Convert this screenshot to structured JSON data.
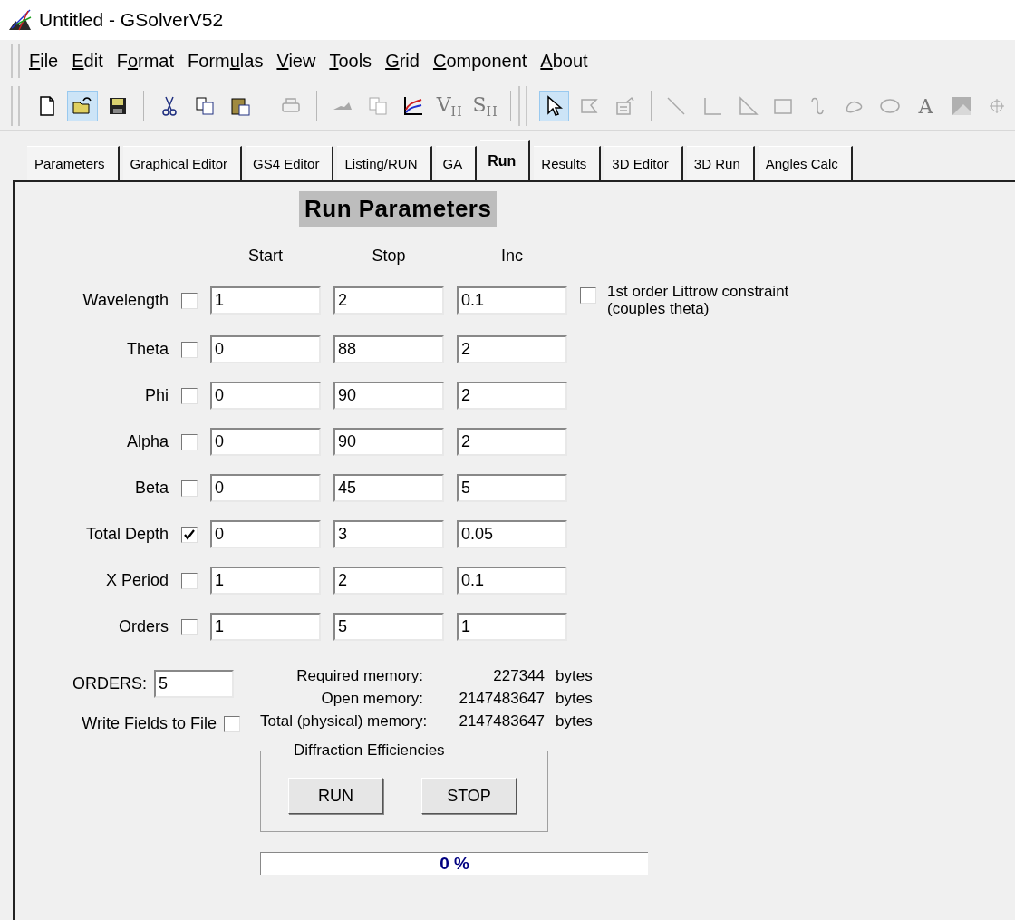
{
  "window": {
    "title": "Untitled - GSolverV52"
  },
  "menu": [
    {
      "key": "F",
      "post": "ile"
    },
    {
      "key": "E",
      "post": "dit"
    },
    {
      "pre": "F",
      "key": "o",
      "post": "rmat"
    },
    {
      "pre": "Form",
      "key": "u",
      "post": "las"
    },
    {
      "key": "V",
      "post": "iew"
    },
    {
      "key": "T",
      "post": "ools"
    },
    {
      "key": "G",
      "post": "rid"
    },
    {
      "key": "C",
      "post": "omponent"
    },
    {
      "key": "A",
      "post": "bout"
    }
  ],
  "toolbar": [
    [
      {
        "disabled": false,
        "pressed": false
      },
      {
        "disabled": false,
        "pressed": true
      },
      {
        "disabled": false,
        "pressed": false
      }
    ],
    [
      {
        "disabled": false,
        "pressed": false
      },
      {
        "disabled": false,
        "pressed": false
      },
      {
        "disabled": false,
        "pressed": false
      }
    ],
    [
      {
        "disabled": true,
        "pressed": false
      }
    ],
    [
      {
        "disabled": true,
        "pressed": false
      },
      {
        "disabled": true,
        "pressed": false
      },
      {
        "disabled": false,
        "pressed": false
      },
      {
        "disabled": true,
        "pressed": false,
        "label": "V$_{H}$"
      },
      {
        "disabled": true,
        "pressed": false,
        "label": "S$_{H}$"
      }
    ]
  ],
  "drawing_toolbar": [
    [
      {
        "disabled": false,
        "pressed": true
      },
      {
        "disabled": true,
        "pressed": false
      },
      {
        "disabled": true,
        "pressed": false
      }
    ],
    [
      {
        "disabled": true,
        "pressed": false
      },
      {
        "disabled": true,
        "pressed": false
      },
      {
        "disabled": true,
        "pressed": false
      },
      {
        "disabled": true,
        "pressed": false
      },
      {
        "disabled": true,
        "pressed": false
      },
      {
        "disabled": true,
        "pressed": false
      },
      {
        "disabled": true,
        "pressed": false
      },
      {
        "disabled": true,
        "pressed": false,
        "label": "A"
      },
      {
        "disabled": true,
        "pressed": false
      },
      {
        "disabled": true,
        "pressed": false
      }
    ]
  ],
  "tabs": [
    {
      "label": "Parameters",
      "selected": false
    },
    {
      "label": "Graphical Editor",
      "selected": false
    },
    {
      "label": "GS4 Editor",
      "selected": false
    },
    {
      "label": "Listing/RUN",
      "selected": false
    },
    {
      "label": "GA",
      "selected": false
    },
    {
      "label": "Run",
      "selected": true
    },
    {
      "label": "Results",
      "selected": false
    },
    {
      "label": "3D Editor",
      "selected": false
    },
    {
      "label": "3D Run",
      "selected": false
    },
    {
      "label": "Angles Calc",
      "selected": false
    }
  ],
  "heading": "Run Parameters",
  "columns": [
    "Start",
    "Stop",
    "Inc"
  ],
  "rows": [
    {
      "label": "Wavelength",
      "checked": false,
      "start": "1",
      "stop": "2",
      "inc": "0.1"
    },
    {
      "label": "Theta",
      "checked": false,
      "start": "0",
      "stop": "88",
      "inc": "2"
    },
    {
      "label": "Phi",
      "checked": false,
      "start": "0",
      "stop": "90",
      "inc": "2"
    },
    {
      "label": "Alpha",
      "checked": false,
      "start": "0",
      "stop": "90",
      "inc": "2"
    },
    {
      "label": "Beta",
      "checked": false,
      "start": "0",
      "stop": "45",
      "inc": "5"
    },
    {
      "label": "Total Depth",
      "checked": true,
      "start": "0",
      "stop": "3",
      "inc": "0.05"
    },
    {
      "label": "X Period",
      "checked": false,
      "start": "1",
      "stop": "2",
      "inc": "0.1"
    },
    {
      "label": "Orders",
      "checked": false,
      "start": "1",
      "stop": "5",
      "inc": "1"
    }
  ],
  "littrow": {
    "label_lines": [
      "1st order Littrow constraint",
      "(couples theta)"
    ],
    "checked": false
  },
  "orders": {
    "label": "ORDERS:",
    "value": "5"
  },
  "write_fields": {
    "label": "Write Fields to File",
    "checked": false
  },
  "memory": [
    {
      "label": "Required memory:",
      "value": "227344",
      "unit": "bytes"
    },
    {
      "label": "Open memory:",
      "value": "2147483647",
      "unit": "bytes"
    },
    {
      "label": "Total (physical) memory:",
      "value": "2147483647",
      "unit": "bytes"
    }
  ],
  "diffraction": {
    "title": "Diffraction Efficiencies",
    "buttons": [
      "RUN",
      "STOP"
    ]
  },
  "progress": {
    "level": 0,
    "reading": "0 %"
  }
}
